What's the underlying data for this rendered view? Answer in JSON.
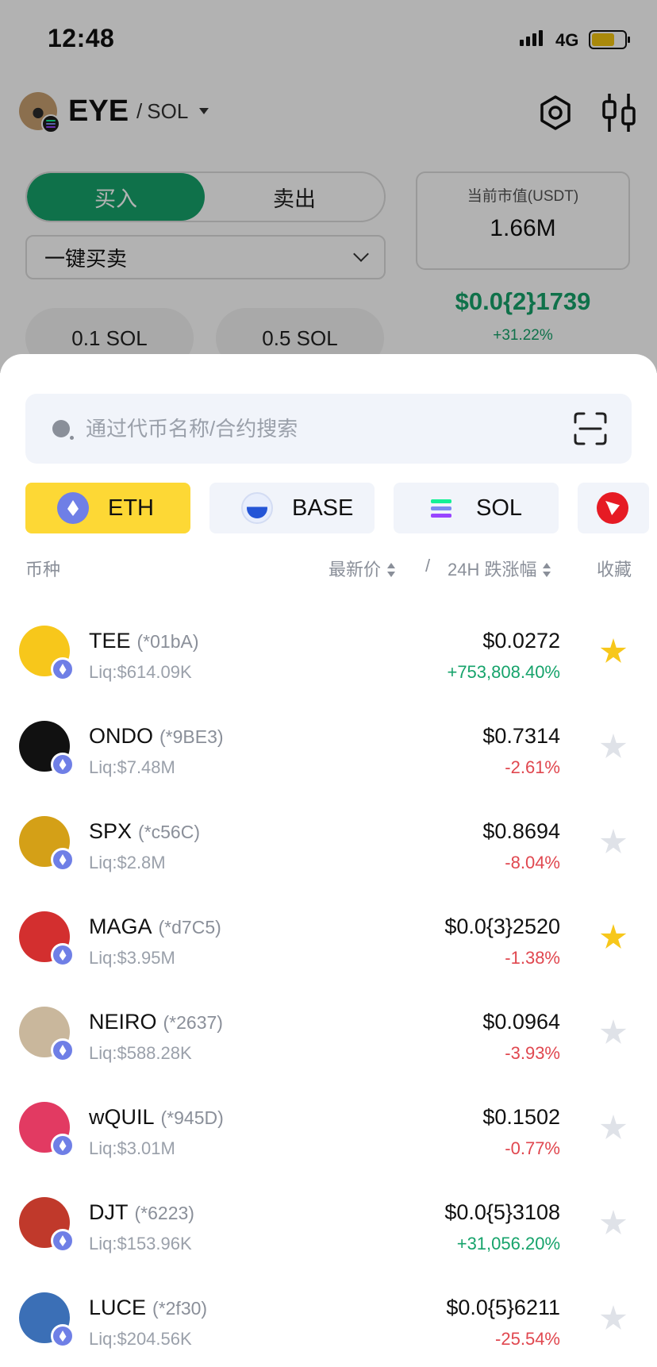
{
  "status_bar": {
    "time": "12:48",
    "network": "4G",
    "battery_level": 0.7
  },
  "pair": {
    "base": "EYE",
    "separator": "/",
    "quote": "SOL"
  },
  "trade": {
    "buy_label": "买入",
    "sell_label": "卖出",
    "mode": "一键买卖",
    "amount_options": [
      "0.1 SOL",
      "0.5 SOL"
    ],
    "market_cap_label": "当前市值(USDT)",
    "market_cap_value": "1.66M",
    "price": "$0.0{2}1739",
    "change": "+31.22%"
  },
  "search": {
    "placeholder": "通过代币名称/合约搜索",
    "value": ""
  },
  "chains": [
    {
      "label": "ETH",
      "icon": "ethereum-icon",
      "active": true
    },
    {
      "label": "BASE",
      "icon": "base-icon",
      "active": false
    },
    {
      "label": "SOL",
      "icon": "solana-icon",
      "active": false
    },
    {
      "label": "",
      "icon": "tron-icon",
      "active": false
    }
  ],
  "list_header": {
    "coin": "币种",
    "price": "最新价",
    "separator": "/",
    "change": "24H 跌涨幅",
    "favorite": "收藏"
  },
  "tokens": [
    {
      "symbol": "TEE",
      "address": "(*01bA)",
      "liq": "Liq:$614.09K",
      "price": "$0.0272",
      "change": "+753,808.40%",
      "direction": "up",
      "favorite": true,
      "avatar_color": "#f7c71b"
    },
    {
      "symbol": "ONDO",
      "address": "(*9BE3)",
      "liq": "Liq:$7.48M",
      "price": "$0.7314",
      "change": "-2.61%",
      "direction": "down",
      "favorite": false,
      "avatar_color": "#111111"
    },
    {
      "symbol": "SPX",
      "address": "(*c56C)",
      "liq": "Liq:$2.8M",
      "price": "$0.8694",
      "change": "-8.04%",
      "direction": "down",
      "favorite": false,
      "avatar_color": "#d4a017"
    },
    {
      "symbol": "MAGA",
      "address": "(*d7C5)",
      "liq": "Liq:$3.95M",
      "price": "$0.0{3}2520",
      "change": "-1.38%",
      "direction": "down",
      "favorite": true,
      "avatar_color": "#d32f2f"
    },
    {
      "symbol": "NEIRO",
      "address": "(*2637)",
      "liq": "Liq:$588.28K",
      "price": "$0.0964",
      "change": "-3.93%",
      "direction": "down",
      "favorite": false,
      "avatar_color": "#c9b79c"
    },
    {
      "symbol": "wQUIL",
      "address": "(*945D)",
      "liq": "Liq:$3.01M",
      "price": "$0.1502",
      "change": "-0.77%",
      "direction": "down",
      "favorite": false,
      "avatar_color": "#e23a62"
    },
    {
      "symbol": "DJT",
      "address": "(*6223)",
      "liq": "Liq:$153.96K",
      "price": "$0.0{5}3108",
      "change": "+31,056.20%",
      "direction": "up",
      "favorite": false,
      "avatar_color": "#c0392b"
    },
    {
      "symbol": "LUCE",
      "address": "(*2f30)",
      "liq": "Liq:$204.56K",
      "price": "$0.0{5}6211",
      "change": "-25.54%",
      "direction": "down",
      "favorite": false,
      "avatar_color": "#3b6fb6"
    }
  ]
}
